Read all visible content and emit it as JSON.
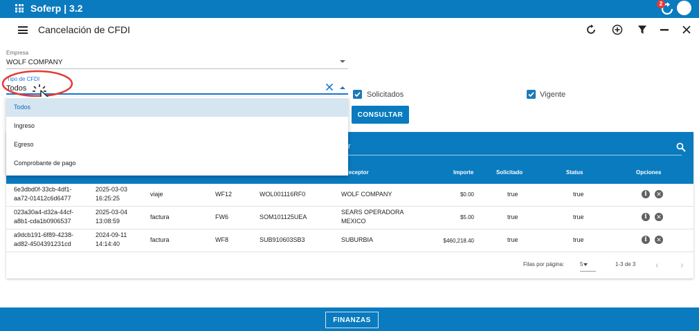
{
  "app": {
    "title": "Soferp | 3.2",
    "notification_count": "2"
  },
  "header": {
    "title": "Cancelación de CFDI"
  },
  "filters": {
    "empresa": {
      "label": "Empresa",
      "value": "WOLF COMPANY"
    },
    "tipo_cfdi": {
      "label": "Tipo de CFDI",
      "value": "Todos",
      "options": [
        "Todos",
        "Ingreso",
        "Egreso",
        "Comprobante de pago"
      ],
      "selected": "Todos"
    },
    "solicitados": {
      "label": "Solicitados",
      "checked": true
    },
    "vigente": {
      "label": "Vigente",
      "checked": true
    },
    "consultar_label": "CONSULTAR"
  },
  "table": {
    "search_partial": "r",
    "headers": {
      "receptor": "Receptor",
      "importe": "Importe",
      "solicitado": "Solicitado",
      "status": "Status",
      "opciones": "Opciones"
    },
    "rows": [
      {
        "uuid1": "6e3dbd0f-33cb-4df1-",
        "uuid2": "aa72-01412c6d6477",
        "date": "2025-03-03",
        "time": "16:25:25",
        "concepto": "viaje",
        "serie": "WF12",
        "rfc": "WOL001116RF0",
        "receptor1": "WOLF COMPANY",
        "receptor2": "",
        "importe": "$0.00",
        "solicitado": "true",
        "status": "true"
      },
      {
        "uuid1": "023a30a4-d32a-44cf-",
        "uuid2": "a8b1-cda1b0906537",
        "date": "2025-03-04",
        "time": "13:08:59",
        "concepto": "factura",
        "serie": "FW6",
        "rfc": "SOM101125UEA",
        "receptor1": "SEARS OPERADORA",
        "receptor2": "MEXICO",
        "importe": "$5.00",
        "solicitado": "true",
        "status": "true"
      },
      {
        "uuid1": "a9dcb191-6f89-4238-",
        "uuid2": "ad82-4504391231cd",
        "date": "2024-09-11",
        "time": "14:14:40",
        "concepto": "factura",
        "serie": "WF8",
        "rfc": "SUB910603SB3",
        "receptor1": "SUBURBIA",
        "receptor2": "",
        "importe": "$460,218.40",
        "solicitado": "true",
        "status": "true"
      }
    ],
    "footer": {
      "rows_per_page_label": "Filas por página:",
      "rows_per_page": "5",
      "range": "1-3 de 3"
    }
  },
  "bottom": {
    "finanzas_label": "FINANZAS"
  },
  "colors": {
    "primary": "#0a7bbf",
    "accent_blue": "#1976d2",
    "selected_bg": "#d5e6f0",
    "annotation_red": "#e53935"
  },
  "icons": [
    "apps-icon",
    "refresh-icon",
    "avatar",
    "menu-icon",
    "refresh-icon",
    "add-circle-icon",
    "filter-icon",
    "minimize-icon",
    "close-icon",
    "clear-icon",
    "search-icon",
    "info-icon",
    "cancel-icon",
    "chevron-left-icon",
    "chevron-right-icon"
  ]
}
